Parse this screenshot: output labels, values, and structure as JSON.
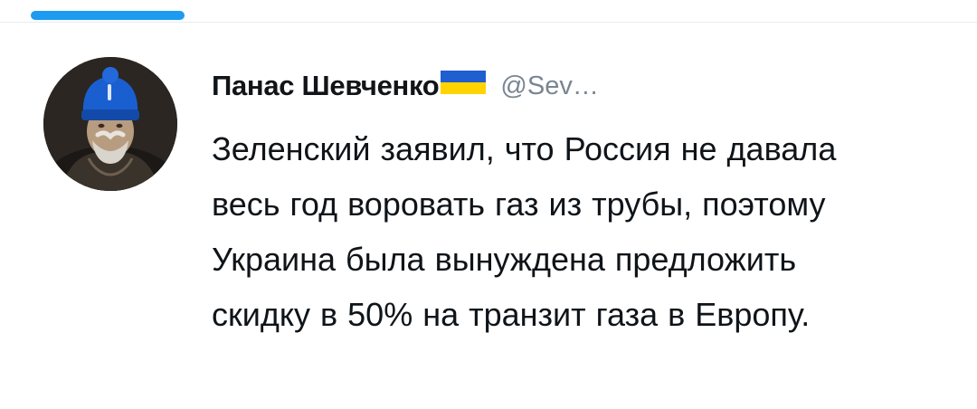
{
  "tweet": {
    "author_name": "Панас Шевченко",
    "author_flag_icon": "ukraine-flag-icon",
    "handle": "@Sev…",
    "text": "Зеленский заявил, что Россия не давала весь год воровать газ из трубы, поэтому Украина была вынуждена предложить скидку в 50% на транзит газа в Европу."
  },
  "colors": {
    "accent": "#1d9bf0",
    "flag_blue": "#1f5fd0",
    "flag_yellow": "#ffd400",
    "text": "#0f1419",
    "muted": "#7a8691"
  }
}
